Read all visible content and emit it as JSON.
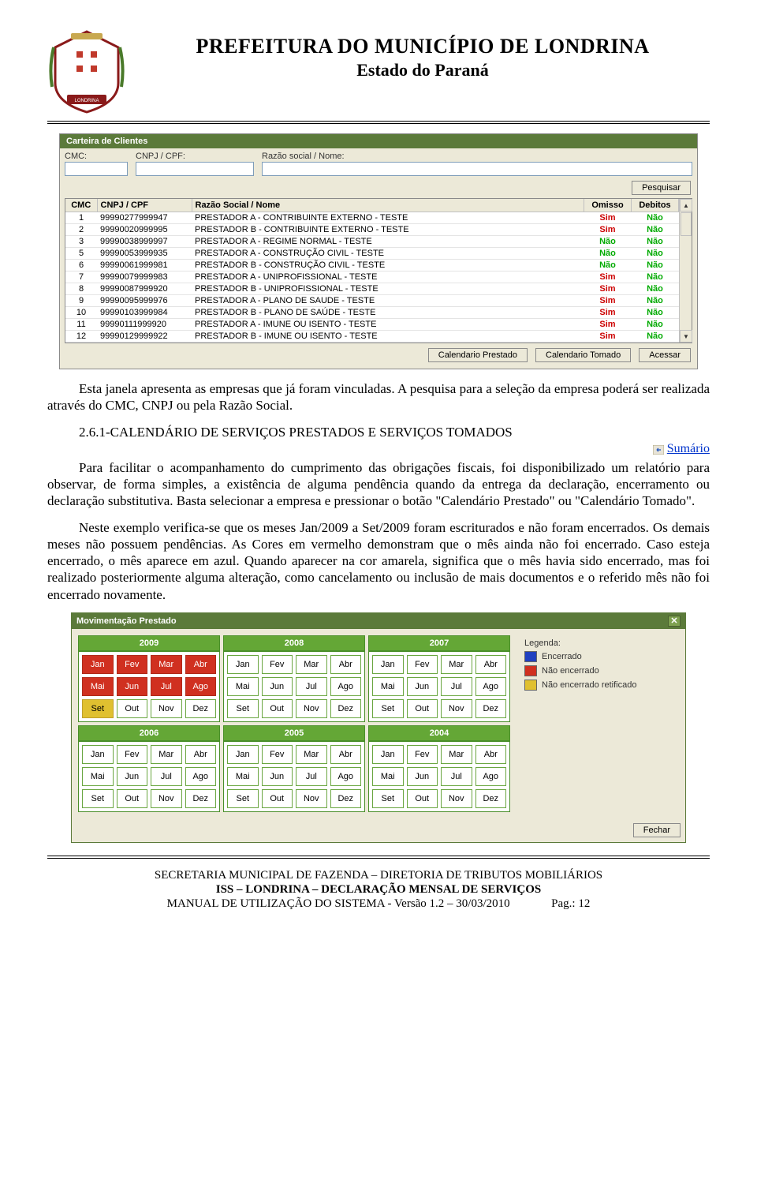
{
  "header": {
    "title": "PREFEITURA DO MUNICÍPIO DE LONDRINA",
    "subtitle": "Estado do Paraná"
  },
  "carteira": {
    "title": "Carteira de Clientes",
    "labels": {
      "cmc": "CMC:",
      "cnpj": "CNPJ / CPF:",
      "razao": "Razão social / Nome:"
    },
    "pesquisar": "Pesquisar",
    "columns": {
      "cmc": "CMC",
      "cnpj": "CNPJ / CPF",
      "razao": "Razão Social / Nome",
      "omisso": "Omisso",
      "debitos": "Debitos"
    },
    "rows": [
      {
        "cmc": "1",
        "cnpj": "99990277999947",
        "razao": "PRESTADOR A - CONTRIBUINTE EXTERNO - TESTE",
        "omisso": "Sim",
        "debitos": "Não"
      },
      {
        "cmc": "2",
        "cnpj": "99990020999995",
        "razao": "PRESTADOR B - CONTRIBUINTE EXTERNO - TESTE",
        "omisso": "Sim",
        "debitos": "Não"
      },
      {
        "cmc": "3",
        "cnpj": "99990038999997",
        "razao": "PRESTADOR A - REGIME NORMAL - TESTE",
        "omisso": "Não",
        "debitos": "Não"
      },
      {
        "cmc": "5",
        "cnpj": "99990053999935",
        "razao": "PRESTADOR A - CONSTRUÇÃO CIVIL - TESTE",
        "omisso": "Não",
        "debitos": "Não"
      },
      {
        "cmc": "6",
        "cnpj": "99990061999981",
        "razao": "PRESTADOR B - CONSTRUÇÃO CIVIL - TESTE",
        "omisso": "Não",
        "debitos": "Não"
      },
      {
        "cmc": "7",
        "cnpj": "99990079999983",
        "razao": "PRESTADOR A - UNIPROFISSIONAL - TESTE",
        "omisso": "Sim",
        "debitos": "Não"
      },
      {
        "cmc": "8",
        "cnpj": "99990087999920",
        "razao": "PRESTADOR B - UNIPROFISSIONAL - TESTE",
        "omisso": "Sim",
        "debitos": "Não"
      },
      {
        "cmc": "9",
        "cnpj": "99990095999976",
        "razao": "PRESTADOR A - PLANO DE SAUDE - TESTE",
        "omisso": "Sim",
        "debitos": "Não"
      },
      {
        "cmc": "10",
        "cnpj": "99990103999984",
        "razao": "PRESTADOR B - PLANO DE SAÚDE - TESTE",
        "omisso": "Sim",
        "debitos": "Não"
      },
      {
        "cmc": "11",
        "cnpj": "99990111999920",
        "razao": "PRESTADOR A - IMUNE OU ISENTO - TESTE",
        "omisso": "Sim",
        "debitos": "Não"
      },
      {
        "cmc": "12",
        "cnpj": "99990129999922",
        "razao": "PRESTADOR B - IMUNE OU ISENTO - TESTE",
        "omisso": "Sim",
        "debitos": "Não"
      }
    ],
    "actions": {
      "cal_prestado": "Calendario Prestado",
      "cal_tomado": "Calendario Tomado",
      "acessar": "Acessar"
    }
  },
  "paragraph1a": "Esta janela apresenta as empresas que já foram vinculadas. A pesquisa para a seleção da empresa poderá ser realizada através do CMC, CNPJ ou pela Razão Social.",
  "section_num": "2.6.1-",
  "section_title": "CALENDÁRIO DE SERVIÇOS PRESTADOS E SERVIÇOS TOMADOS",
  "sumario": "Sumário",
  "paragraph2": "Para facilitar o acompanhamento do cumprimento das obrigações fiscais, foi disponibilizado um relatório para observar, de forma simples, a existência de alguma pendência quando da entrega da declaração, encerramento ou declaração substitutiva. Basta selecionar a empresa e pressionar o botão \"Calendário Prestado\" ou \"Calendário Tomado\".",
  "paragraph3": "Neste exemplo verifica-se que os meses Jan/2009 a Set/2009 foram escriturados e não foram encerrados. Os demais meses não possuem pendências. As Cores em vermelho demonstram que o mês ainda não foi encerrado. Caso esteja encerrado, o mês aparece em azul. Quando aparecer na cor amarela, significa que o mês havia sido encerrado, mas foi realizado posteriormente alguma alteração, como cancelamento ou inclusão de mais documentos e o referido mês não foi encerrado novamente.",
  "mov": {
    "title": "Movimentação Prestado",
    "years": [
      "2009",
      "2008",
      "2007",
      "2006",
      "2005",
      "2004"
    ],
    "months": [
      "Jan",
      "Fev",
      "Mar",
      "Abr",
      "Mai",
      "Jun",
      "Jul",
      "Ago",
      "Set",
      "Out",
      "Nov",
      "Dez"
    ],
    "status_2009": [
      "red",
      "red",
      "red",
      "red",
      "red",
      "red",
      "red",
      "red",
      "yellow",
      "",
      "",
      ""
    ],
    "legend_title": "Legenda:",
    "legend": {
      "enc": "Encerrado",
      "nenc": "Não encerrado",
      "nret": "Não encerrado retificado"
    },
    "fechar": "Fechar"
  },
  "footer": {
    "l1": "SECRETARIA MUNICIPAL DE FAZENDA – DIRETORIA DE TRIBUTOS MOBILIÁRIOS",
    "l2": "ISS – LONDRINA – DECLARAÇÃO MENSAL DE SERVIÇOS",
    "l3a": "MANUAL DE UTILIZAÇÃO DO SISTEMA  - Versão 1.2 – 30/03/2010",
    "l3b": "Pag.: 12"
  }
}
